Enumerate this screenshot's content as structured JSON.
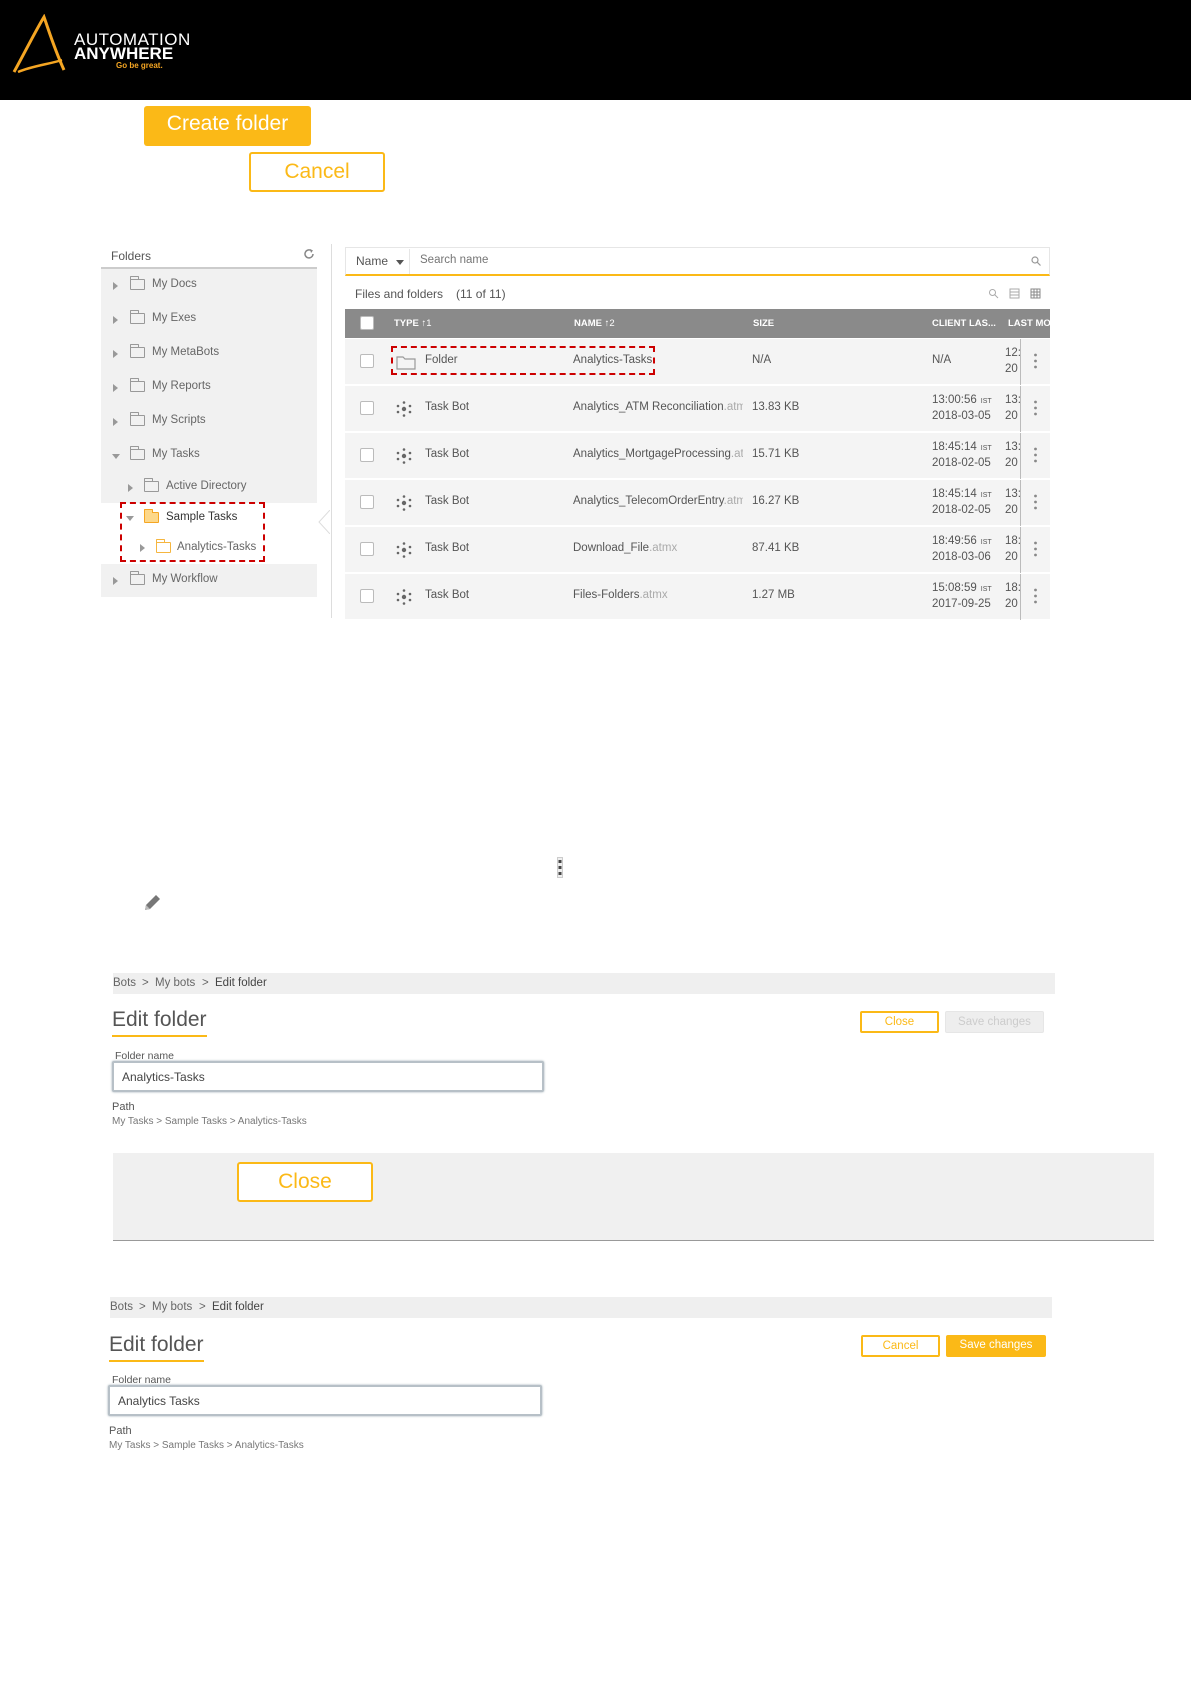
{
  "brand": {
    "line1": "AUTOMATION",
    "line2": "ANYWHERE",
    "tagline": "Go be great."
  },
  "buttons": {
    "create_folder": "Create folder",
    "cancel": "Cancel",
    "close": "Close"
  },
  "folders_panel": {
    "title": "Folders",
    "items": [
      {
        "label": "My Docs"
      },
      {
        "label": "My Exes"
      },
      {
        "label": "My MetaBots"
      },
      {
        "label": "My Reports"
      },
      {
        "label": "My Scripts"
      },
      {
        "label": "My Tasks"
      },
      {
        "label": "Active Directory"
      },
      {
        "label": "Sample Tasks"
      },
      {
        "label": "Analytics-Tasks"
      },
      {
        "label": "My Workflow"
      }
    ]
  },
  "files_panel": {
    "sort_field": "Name",
    "search_placeholder": "Search name",
    "title": "Files and folders",
    "count": "(11 of 11)",
    "columns": {
      "type": "TYPE",
      "type_sort": "↑1",
      "name": "NAME",
      "name_sort": "↑2",
      "size": "SIZE",
      "client_last": "CLIENT LAS...",
      "last_mod": "LAST MO"
    },
    "rows": [
      {
        "type": "Folder",
        "name": "Analytics-Tasks",
        "ext": "",
        "size": "N/A",
        "client_time": "N/A",
        "client_date": "",
        "lm1": "12:",
        "lm2": "20"
      },
      {
        "type": "Task Bot",
        "name": "Analytics_ATM Reconciliation",
        "ext": ".atmx",
        "size": "13.83 KB",
        "client_time": "13:00:56",
        "client_date": "2018-03-05",
        "lm1": "13:",
        "lm2": "20"
      },
      {
        "type": "Task Bot",
        "name": "Analytics_MortgageProcessing",
        "ext": ".atmx",
        "size": "15.71 KB",
        "client_time": "18:45:14",
        "client_date": "2018-02-05",
        "lm1": "13:",
        "lm2": "20"
      },
      {
        "type": "Task Bot",
        "name": "Analytics_TelecomOrderEntry",
        "ext": ".atmx",
        "size": "16.27 KB",
        "client_time": "18:45:14",
        "client_date": "2018-02-05",
        "lm1": "13:",
        "lm2": "20"
      },
      {
        "type": "Task Bot",
        "name": "Download_File",
        "ext": ".atmx",
        "size": "87.41 KB",
        "client_time": "18:49:56",
        "client_date": "2018-03-06",
        "lm1": "18:",
        "lm2": "20"
      },
      {
        "type": "Task Bot",
        "name": "Files-Folders",
        "ext": ".atmx",
        "size": "1.27 MB",
        "client_time": "15:08:59",
        "client_date": "2017-09-25",
        "lm1": "18:",
        "lm2": "20"
      }
    ],
    "tz": "IST"
  },
  "edit1": {
    "crumbs": [
      "Bots",
      ">",
      "My bots",
      ">",
      "Edit folder"
    ],
    "title": "Edit folder",
    "btn_close": "Close",
    "btn_save": "Save changes",
    "folder_label": "Folder name",
    "folder_value": "Analytics-Tasks",
    "path_label": "Path",
    "path_value": "My Tasks > Sample Tasks > Analytics-Tasks"
  },
  "edit2": {
    "crumbs": [
      "Bots",
      ">",
      "My bots",
      ">",
      "Edit folder"
    ],
    "title": "Edit folder",
    "btn_cancel": "Cancel",
    "btn_save": "Save changes",
    "folder_label": "Folder name",
    "folder_value": "Analytics Tasks",
    "path_label": "Path",
    "path_value": "My Tasks > Sample Tasks > Analytics-Tasks"
  },
  "colors": {
    "accent": "#fbb917",
    "highlight_dash": "#cc0000",
    "header_bg": "#000000"
  }
}
